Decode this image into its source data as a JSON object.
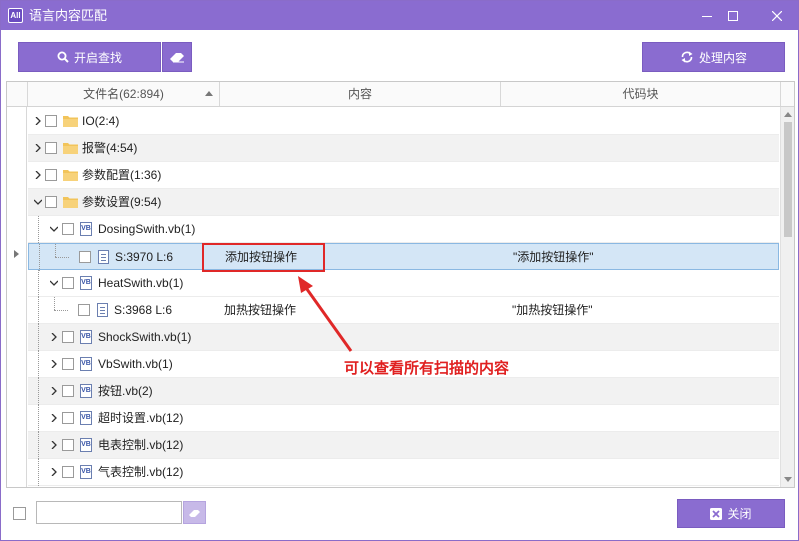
{
  "window": {
    "icon_text": "All",
    "title": "语言内容匹配"
  },
  "toolbar": {
    "start_search_label": "开启查找",
    "process_content_label": "处理内容"
  },
  "grid": {
    "columns": [
      "文件名(62:894)",
      "内容",
      "代码块"
    ],
    "rows": [
      {
        "name": "IO(2:4)"
      },
      {
        "name": "报警(4:54)"
      },
      {
        "name": "参数配置(1:36)"
      },
      {
        "name": "参数设置(9:54)"
      },
      {
        "name": "DosingSwith.vb(1)"
      },
      {
        "name": "S:3970   L:6",
        "content": "添加按钮操作",
        "code": "\"添加按钮操作\""
      },
      {
        "name": "HeatSwith.vb(1)"
      },
      {
        "name": "S:3968   L:6",
        "content": "加热按钮操作",
        "code": "\"加热按钮操作\""
      },
      {
        "name": "ShockSwith.vb(1)"
      },
      {
        "name": "VbSwith.vb(1)"
      },
      {
        "name": "按钮.vb(2)"
      },
      {
        "name": "超时设置.vb(12)"
      },
      {
        "name": "电表控制.vb(12)"
      },
      {
        "name": "气表控制.vb(12)"
      }
    ]
  },
  "annotation": {
    "text": "可以查看所有扫描的内容",
    "color": "#e02020"
  },
  "bottom": {
    "input_value": "",
    "close_label": "关闭"
  },
  "colors": {
    "accent": "#8a6cd0",
    "selected_row": "#d4e6f6",
    "folder": "#f2c45a"
  },
  "icons": {
    "window": "app-icon",
    "minimize": "minimize-icon",
    "maximize": "maximize-icon",
    "close": "close-icon",
    "search": "search-icon",
    "eraser": "eraser-icon",
    "process": "refresh-icon",
    "folder": "folder-icon",
    "vb_file": "vb-file-icon",
    "code": "code-block-icon"
  }
}
